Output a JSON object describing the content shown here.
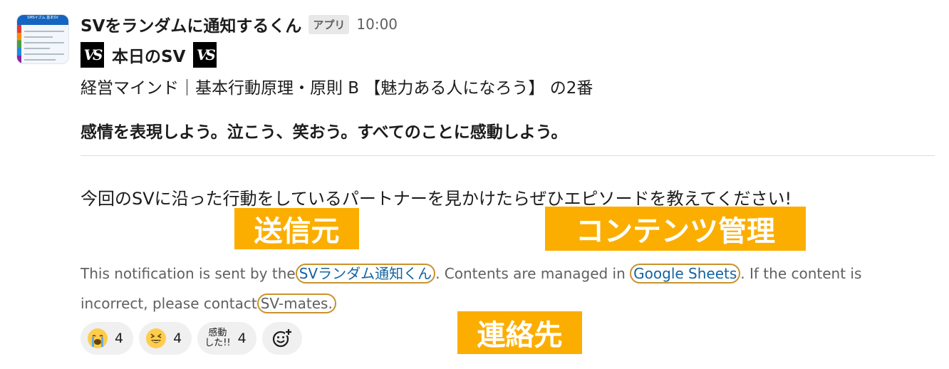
{
  "message": {
    "app_name": "SVをランダムに通知するくん",
    "app_badge": "アプリ",
    "time": "10:00",
    "avatar_header": "SMSイズム 基本SV",
    "title": "本日のSV",
    "vs_logo_text": "VS",
    "category": "経営マインド｜基本行動原理・原則 B 【魅力ある人になろう】 の2番",
    "principle": "感情を表現しよう。泣こう、笑おう。すべてのことに感動しよう。",
    "request": "今回のSVに沿った行動をしているパートナーを見かけたらぜひエピソードを教えてください!",
    "notice": {
      "part1": "This notification is sent by the",
      "sender_link": "SVランダム通知くん",
      "part2": ". Contents are managed in",
      "sheets_link": "Google Sheets",
      "part3": ". If the content is incorrect, please contact",
      "contact": "SV-mates",
      "part4": "."
    }
  },
  "callouts": {
    "sender": "送信元",
    "contents": "コンテンツ管理",
    "contact": "連絡先"
  },
  "reactions": [
    {
      "emoji": "loudly-crying-face",
      "count": "4"
    },
    {
      "emoji": "laughing-face",
      "count": "4"
    },
    {
      "emoji": "custom-kandou-shita",
      "label_line1": "感動",
      "label_line2": "した!!",
      "count": "4"
    }
  ],
  "colors": {
    "callout_bg": "#fbae00",
    "link": "#1264a3",
    "circle_outline": "#c9922e",
    "muted_text": "#616061"
  }
}
